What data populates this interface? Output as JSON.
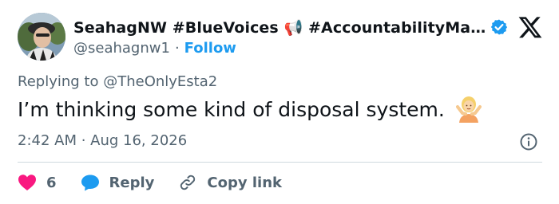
{
  "author": {
    "display_name": "SeahagNW #BlueVoices 📢 #AccountabilityMa…",
    "handle": "@seahagnw1",
    "separator": "·",
    "follow_label": "Follow",
    "avatar_icon": "profile-photo"
  },
  "tweet": {
    "reply_prefix": "Replying to",
    "reply_to": "@TheOnlyEsta2",
    "text": "I’m thinking some kind of disposal system.",
    "emoji_icon": "person-shrugging-emoji",
    "timestamp": "2:42 AM · Aug 16, 2026"
  },
  "actions": {
    "like_count": "6",
    "reply_label": "Reply",
    "copy_label": "Copy link"
  },
  "colors": {
    "accent": "#1d9bf0",
    "like": "#f91880",
    "text": "#0f1419",
    "muted": "#536471"
  }
}
